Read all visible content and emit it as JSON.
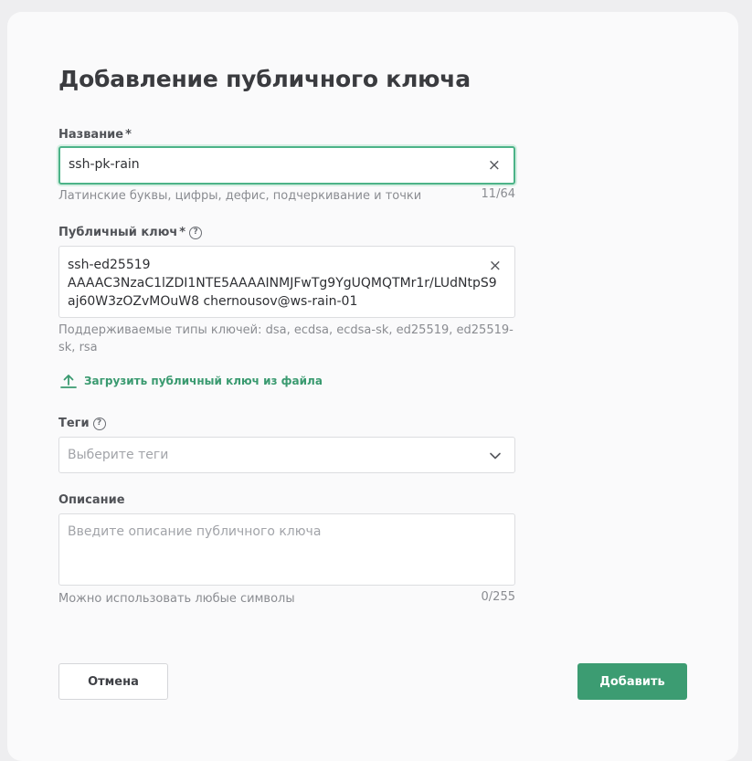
{
  "form": {
    "title": "Добавление публичного ключа",
    "required_mark": "*",
    "help_glyph": "?",
    "clear_glyph": "×",
    "name": {
      "label": "Название",
      "value": "ssh-pk-rain",
      "hint": "Латинские буквы, цифры, дефис, подчеркивание и точки",
      "counter": "11/64"
    },
    "public_key": {
      "label": "Публичный ключ",
      "value": "ssh-ed25519\nAAAAC3NzaC1lZDI1NTE5AAAAINMJFwTg9YgUQMQTMr1r/LUdNtpS9\naj60W3zOZvMOuW8 chernousov@ws-rain-01",
      "hint": "Поддерживаемые типы ключей: dsa, ecdsa, ecdsa-sk, ed25519, ed25519-sk, rsa"
    },
    "upload_link": "Загрузить публичный ключ из файла",
    "tags": {
      "label": "Теги",
      "placeholder": "Выберите теги"
    },
    "description": {
      "label": "Описание",
      "placeholder": "Введите описание публичного ключа",
      "hint": "Можно использовать любые символы",
      "counter": "0/255"
    },
    "cancel_label": "Отмена",
    "submit_label": "Добавить"
  },
  "colors": {
    "accent": "#3c9c72",
    "focus_border": "#4cb388",
    "text": "#3a3b3f",
    "muted": "#8a8c91"
  },
  "icons": {
    "clear": "close-icon",
    "help": "question-circle-icon",
    "upload": "upload-icon",
    "dropdown": "chevron-down-icon"
  }
}
